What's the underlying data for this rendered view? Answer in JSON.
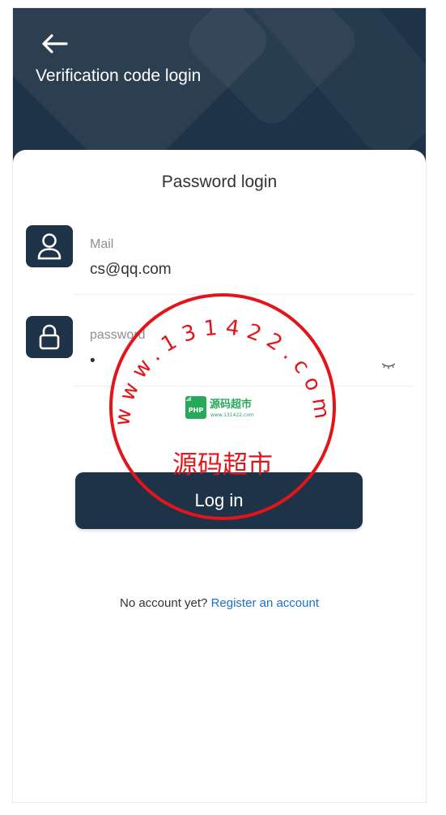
{
  "header": {
    "back_icon": "arrow-left-icon",
    "title": "Verification code login"
  },
  "form": {
    "title": "Password login",
    "mail": {
      "icon": "user-icon",
      "label": "Mail",
      "value": "cs@qq.com"
    },
    "password": {
      "icon": "lock-icon",
      "label": "password",
      "value": "•",
      "toggle_icon": "eye-closed-icon"
    },
    "submit_label": "Log in",
    "register_prompt": "No account yet?",
    "register_link": "Register an account"
  },
  "watermark": {
    "ring_text": "www.131422.com",
    "cn_text": "源码超市",
    "logo_text": "源码超市",
    "logo_sub": "www.131422.com",
    "logo_badge": "PHP"
  },
  "colors": {
    "primary": "#1e3347",
    "link": "#1a6fd1",
    "stamp": "#e3151a"
  }
}
